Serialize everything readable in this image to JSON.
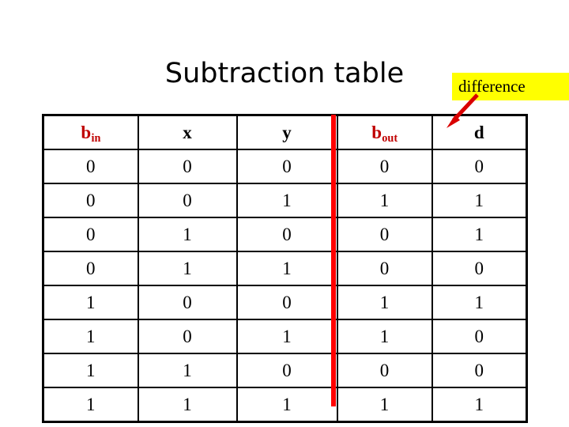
{
  "slide": {
    "title": "Subtraction table",
    "background_color": "#FFFFFF"
  },
  "callout": {
    "label": "difference",
    "background_color": "#FFFF00",
    "arrow_color": "#FF0000",
    "arrow_icon": "arrow-down-left-icon",
    "points_to_column": "d"
  },
  "table": {
    "accent_divider_color": "#FF0000",
    "header_red_color": "#C00000",
    "border_color": "#000000",
    "headers": [
      {
        "text": "b",
        "sub": "in",
        "color": "red"
      },
      {
        "text": "x",
        "sub": "",
        "color": "black"
      },
      {
        "text": "y",
        "sub": "",
        "color": "black"
      },
      {
        "text": "b",
        "sub": "out",
        "color": "red"
      },
      {
        "text": "d",
        "sub": "",
        "color": "black"
      }
    ],
    "rows": [
      [
        "0",
        "0",
        "0",
        "0",
        "0"
      ],
      [
        "0",
        "0",
        "1",
        "1",
        "1"
      ],
      [
        "0",
        "1",
        "0",
        "0",
        "1"
      ],
      [
        "0",
        "1",
        "1",
        "0",
        "0"
      ],
      [
        "1",
        "0",
        "0",
        "1",
        "1"
      ],
      [
        "1",
        "0",
        "1",
        "1",
        "0"
      ],
      [
        "1",
        "1",
        "0",
        "0",
        "0"
      ],
      [
        "1",
        "1",
        "1",
        "1",
        "1"
      ]
    ]
  }
}
